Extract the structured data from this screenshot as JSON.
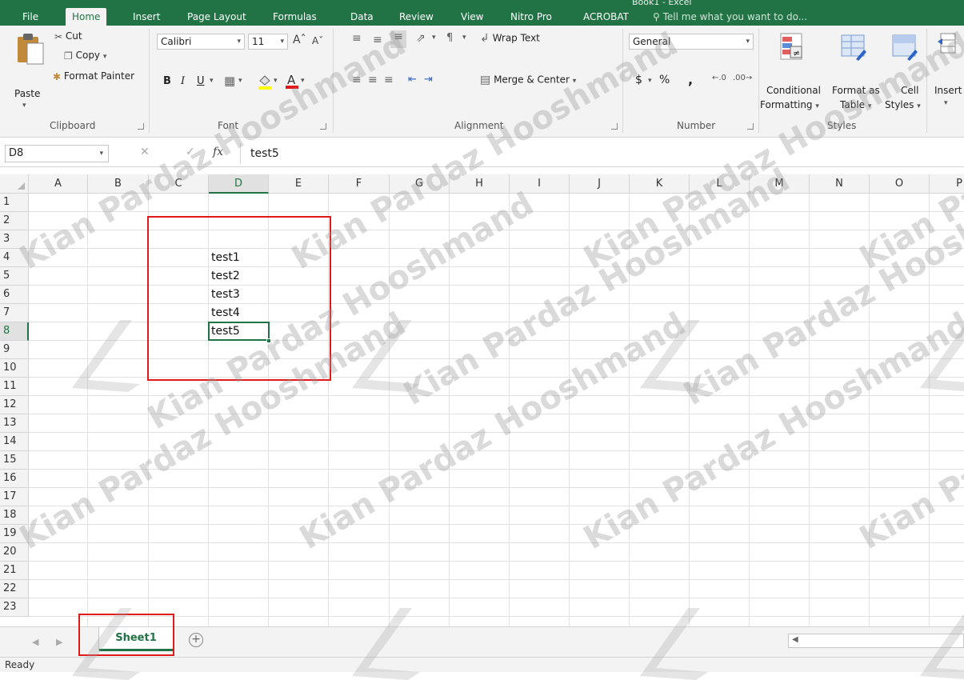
{
  "window": {
    "title": "Book1 - Excel"
  },
  "tabs": [
    {
      "label": "File"
    },
    {
      "label": "Home"
    },
    {
      "label": "Insert"
    },
    {
      "label": "Page Layout"
    },
    {
      "label": "Formulas"
    },
    {
      "label": "Data"
    },
    {
      "label": "Review"
    },
    {
      "label": "View"
    },
    {
      "label": "Nitro Pro"
    },
    {
      "label": "ACROBAT"
    }
  ],
  "tell_me": "Tell me what you want to do...",
  "ribbon": {
    "clipboard": {
      "paste": "Paste",
      "cut": "Cut",
      "copy": "Copy",
      "format_painter": "Format Painter",
      "label": "Clipboard"
    },
    "font": {
      "name": "Calibri",
      "size": "11",
      "bold": "B",
      "italic": "I",
      "underline": "U",
      "label": "Font"
    },
    "alignment": {
      "wrap_text": "Wrap Text",
      "merge_center": "Merge & Center",
      "label": "Alignment"
    },
    "number": {
      "format": "General",
      "currency": "$",
      "percent": "%",
      "comma": ",",
      "label": "Number"
    },
    "styles": {
      "conditional": "Conditional",
      "conditional2": "Formatting",
      "format_as": "Format as",
      "format_as2": "Table",
      "cell": "Cell",
      "cell2": "Styles",
      "label": "Styles"
    },
    "cells": {
      "insert": "Insert"
    }
  },
  "formula_bar": {
    "name_box": "D8",
    "fx": "fx",
    "value": "test5"
  },
  "grid": {
    "columns": [
      "A",
      "B",
      "C",
      "D",
      "E",
      "F",
      "G",
      "H",
      "I",
      "J",
      "K",
      "L",
      "M",
      "N",
      "O",
      "P"
    ],
    "rows": [
      "1",
      "2",
      "3",
      "4",
      "5",
      "6",
      "7",
      "8",
      "9",
      "10",
      "11",
      "12",
      "13",
      "14",
      "15",
      "16",
      "17",
      "18",
      "19",
      "20",
      "21",
      "22",
      "23"
    ],
    "selected_column": "D",
    "selected_row": "8",
    "cells": [
      {
        "ref": "D4",
        "value": "test1"
      },
      {
        "ref": "D5",
        "value": "test2"
      },
      {
        "ref": "D6",
        "value": "test3"
      },
      {
        "ref": "D7",
        "value": "test4"
      },
      {
        "ref": "D8",
        "value": "test5"
      }
    ]
  },
  "sheets": [
    {
      "label": "Sheet1"
    }
  ],
  "status": "Ready",
  "watermark": "Kian Pardaz Hooshmand",
  "colors": {
    "excel_green": "#217346",
    "highlight_red": "#e01a1a"
  }
}
